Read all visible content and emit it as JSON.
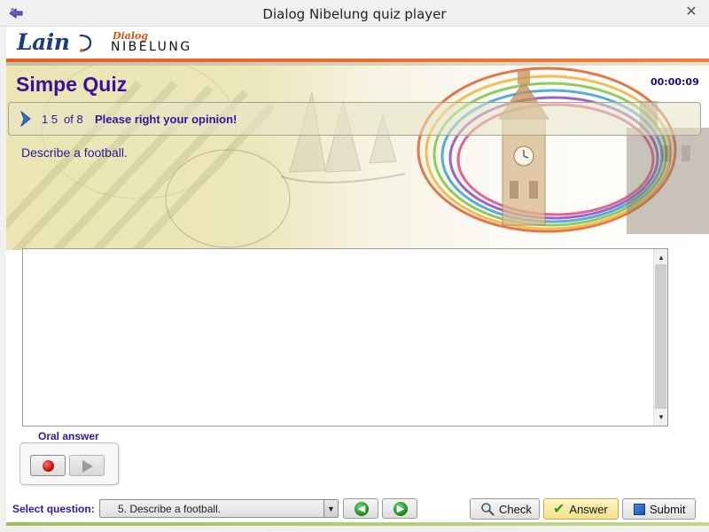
{
  "window": {
    "title": "Dialog Nibelung quiz player",
    "close_icon": "close-icon",
    "close_glyph": "✕"
  },
  "branding": {
    "lain": "Lain",
    "dialog": "Dialog",
    "nibelung": "Nibelung",
    "colors": {
      "orange": "#e85d1d",
      "navy": "#1d3a82"
    }
  },
  "quiz": {
    "title": "Simpe Quiz",
    "timer": "00:00:09",
    "question_number": "1 5",
    "question_of": "of 8",
    "instruction": "Please right your opinion!",
    "question_text": "Describe a football.",
    "accent_color": "#2a1aa0"
  },
  "answer": {
    "text": "",
    "scroll_up_glyph": "▲",
    "scroll_down_glyph": "▼"
  },
  "oral": {
    "label": "Oral answer",
    "record_icon": "record-icon",
    "play_icon": "play-icon"
  },
  "footer": {
    "select_label": "Select question:",
    "selected_question": "5. Describe a football.",
    "dropdown_glyph": "▼",
    "prev_glyph": "◀",
    "next_glyph": "▶",
    "check_label": "Check",
    "answer_label": "Answer",
    "submit_label": "Submit",
    "check_glyph": "✔",
    "search_icon": "search-icon"
  }
}
